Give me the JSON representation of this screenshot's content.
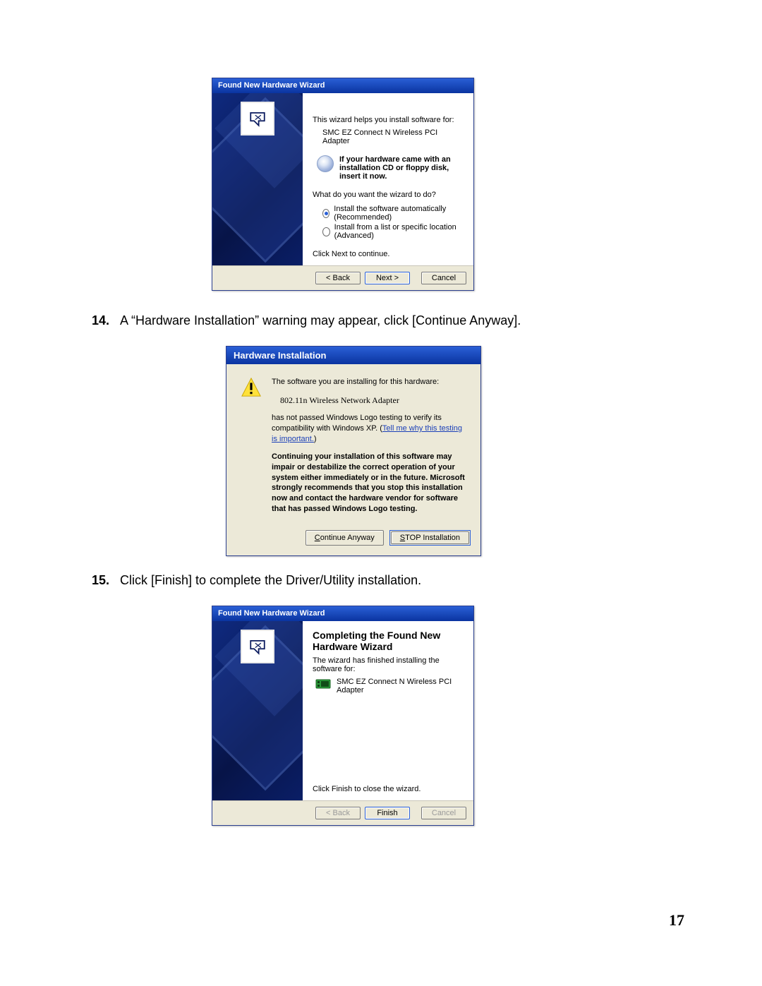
{
  "steps": {
    "s14": {
      "num": "14.",
      "text": "A “Hardware Installation” warning may appear, click [Continue Anyway]."
    },
    "s15": {
      "num": "15.",
      "text": "Click [Finish] to complete the Driver/Utility installation."
    }
  },
  "dialog1": {
    "title": "Found New Hardware Wizard",
    "intro": "This wizard helps you install software for:",
    "device": "SMC EZ Connect N Wireless PCI Adapter",
    "cd_hint": "If your hardware came with an installation CD or floppy disk, insert it now.",
    "prompt": "What do you want the wizard to do?",
    "opt1": "Install the software automatically (Recommended)",
    "opt2": "Install from a list or specific location (Advanced)",
    "continue_hint": "Click Next to continue.",
    "btn_back": "< Back",
    "btn_next": "Next >",
    "btn_cancel": "Cancel"
  },
  "dialog2": {
    "title": "Hardware Installation",
    "line1": "The software you are installing for this hardware:",
    "device": "802.11n Wireless Network Adapter",
    "line2a": "has not passed Windows Logo testing to verify its compatibility with Windows XP. (",
    "link": "Tell me why this testing is important.",
    "line2b": ")",
    "warn": "Continuing your installation of this software may impair or destabilize the correct operation of your system either immediately or in the future. Microsoft strongly recommends that you stop this installation now and contact the hardware vendor for software that has passed Windows Logo testing.",
    "btn_continue_pre": "C",
    "btn_continue_post": "ontinue Anyway",
    "btn_stop_pre": "S",
    "btn_stop_post": "TOP Installation"
  },
  "dialog3": {
    "title": "Found New Hardware Wizard",
    "heading": "Completing the Found New Hardware Wizard",
    "line1": "The wizard has finished installing the software for:",
    "device": "SMC EZ Connect N Wireless PCI Adapter",
    "close_hint": "Click Finish to close the wizard.",
    "btn_back": "< Back",
    "btn_finish": "Finish",
    "btn_cancel": "Cancel"
  },
  "page_number": "17"
}
